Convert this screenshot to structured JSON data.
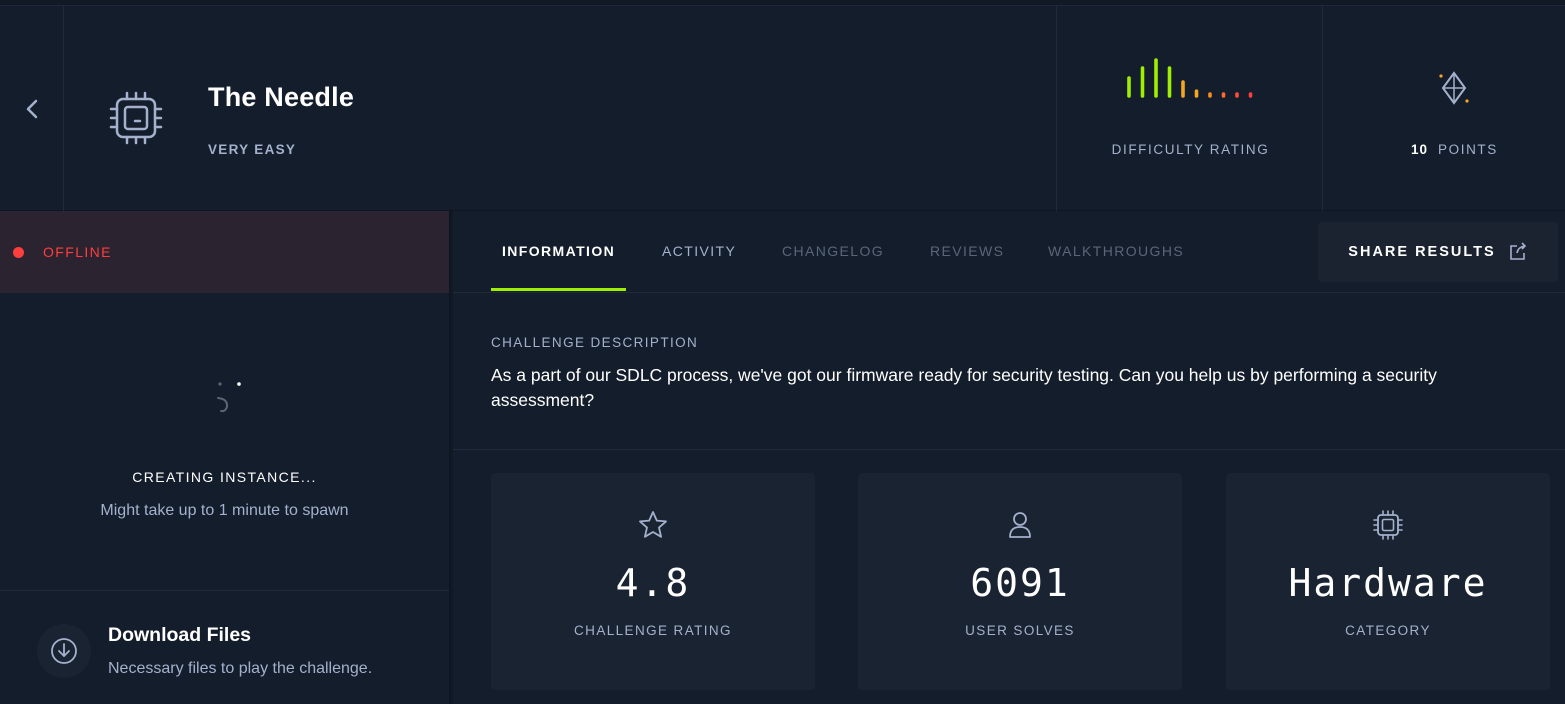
{
  "challenge": {
    "title": "The Needle",
    "difficulty_text": "VERY EASY",
    "difficulty_label": "DIFFICULTY RATING",
    "points_value": "10",
    "points_label": "POINTS"
  },
  "difficulty_chart": {
    "bar_colors": [
      "#9fef00",
      "#9fef00",
      "#9fef00",
      "#9fef00",
      "#f5a623",
      "#f5a623",
      "#ff8c1a",
      "#ff6a2a",
      "#ff4d3a",
      "#ff3e3e"
    ],
    "levels": [
      0.45,
      0.7,
      0.9,
      0.7,
      0.35,
      0.12,
      0.04,
      0.04,
      0.04,
      0.04
    ]
  },
  "instance": {
    "status": "OFFLINE",
    "status_color": "#ff3e3e",
    "creating_text": "CREATING INSTANCE...",
    "note": "Might take up to 1 minute to spawn"
  },
  "download": {
    "title": "Download Files",
    "description": "Necessary files to play the challenge."
  },
  "tabs": [
    {
      "label": "INFORMATION",
      "state": "active"
    },
    {
      "label": "ACTIVITY",
      "state": "normal"
    },
    {
      "label": "CHANGELOG",
      "state": "disabled"
    },
    {
      "label": "REVIEWS",
      "state": "disabled"
    },
    {
      "label": "WALKTHROUGHS",
      "state": "disabled"
    }
  ],
  "share_label": "SHARE RESULTS",
  "description": {
    "heading": "CHALLENGE DESCRIPTION",
    "text": "As a part of our SDLC process, we've got our firmware ready for security testing. Can you help us by performing a security assessment?"
  },
  "stats": [
    {
      "icon": "star-icon",
      "value": "4.8",
      "label": "CHALLENGE RATING"
    },
    {
      "icon": "user-icon",
      "value": "6091",
      "label": "USER SOLVES"
    },
    {
      "icon": "chip-icon",
      "value": "Hardware",
      "label": "CATEGORY"
    }
  ],
  "colors": {
    "accent": "#9fef00",
    "background": "#141d2b",
    "card": "#1a2332",
    "muted_text": "#a4b1cd"
  }
}
